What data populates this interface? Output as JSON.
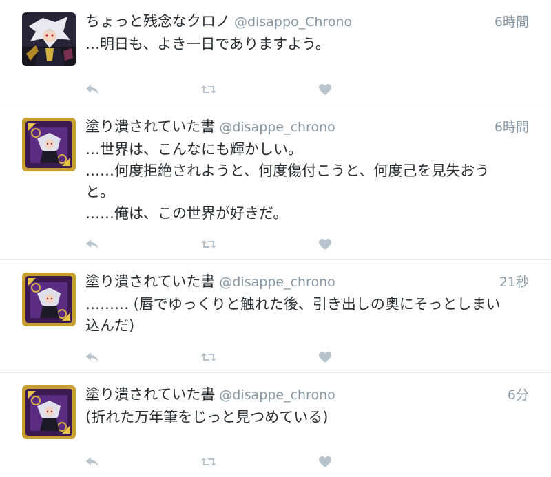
{
  "tweets": [
    {
      "name": "ちょっと残念なクロノ",
      "handle": "@disappo_Chrono",
      "time": "6時間",
      "text": "…明日も、よき一日でありますよう。",
      "avatar_icon": "character-avatar"
    },
    {
      "name": "塗り潰されていた書",
      "handle": "@disappe_chrono",
      "time": "6時間",
      "text": "…世界は、こんなにも輝かしい。\n……何度拒絶されようと、何度傷付こうと、何度己を見失おう\nと。\n……俺は、この世界が好きだ。",
      "avatar_icon": "book-avatar"
    },
    {
      "name": "塗り潰されていた書",
      "handle": "@disappe_chrono",
      "time": "21秒",
      "text": "……… (唇でゆっくりと触れた後、引き出しの奥にそっとしまい\n込んだ)",
      "avatar_icon": "book-avatar"
    },
    {
      "name": "塗り潰されていた書",
      "handle": "@disappe_chrono",
      "time": "6分",
      "text": "(折れた万年筆をじっと見つめている)",
      "avatar_icon": "book-avatar"
    }
  ],
  "actions": {
    "reply_icon": "reply-icon",
    "retweet_icon": "retweet-icon",
    "like_icon": "heart-icon"
  },
  "colors": {
    "icon": "#b7c4cd",
    "muted_text": "#8899a6",
    "divider": "#e1e8ed",
    "avatar_gold": "#c8a032",
    "avatar_purple": "#5a2d82"
  }
}
